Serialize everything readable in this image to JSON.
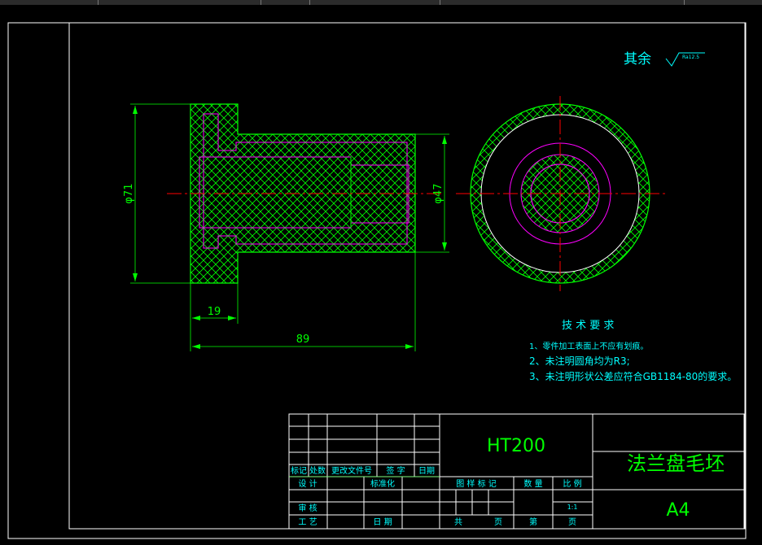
{
  "drawing": {
    "surface_note_label": "其余",
    "roughness_value": "Ra12.5",
    "dimensions": {
      "diameter_71": "φ71",
      "diameter_47": "φ47",
      "length_19": "19",
      "length_89": "89"
    },
    "tech_requirements": {
      "title": "技 术 要 求",
      "items": [
        "1、零件加工表面上不应有划痕。",
        "2、未注明圆角均为R3;",
        "3、未注明形状公差应符合GB1184-80的要求。"
      ]
    }
  },
  "title_block": {
    "material": "HT200",
    "part_name": "法兰盘毛坯",
    "sheet_size": "A4",
    "labels": {
      "mark": "标记",
      "count": "处数",
      "change_doc": "更改文件号",
      "signature": "签 字",
      "date_short": "日期",
      "design": "设 计",
      "standardize": "标准化",
      "review": "审 核",
      "process": "工 艺",
      "date": "日 期",
      "drawing_mark": "图 样 标 记",
      "quantity": "数 量",
      "scale": "比 例",
      "scale_value": "1:1",
      "total": "共",
      "sheet": "页",
      "num": "第",
      "page": "页"
    }
  },
  "colors": {
    "background": "#000000",
    "outline": "#00ff00",
    "hidden_line": "#ff00ff",
    "center_line": "#ff0000",
    "annotation": "#00ffff",
    "title_text": "#00ff00",
    "frame": "#ffffff"
  }
}
